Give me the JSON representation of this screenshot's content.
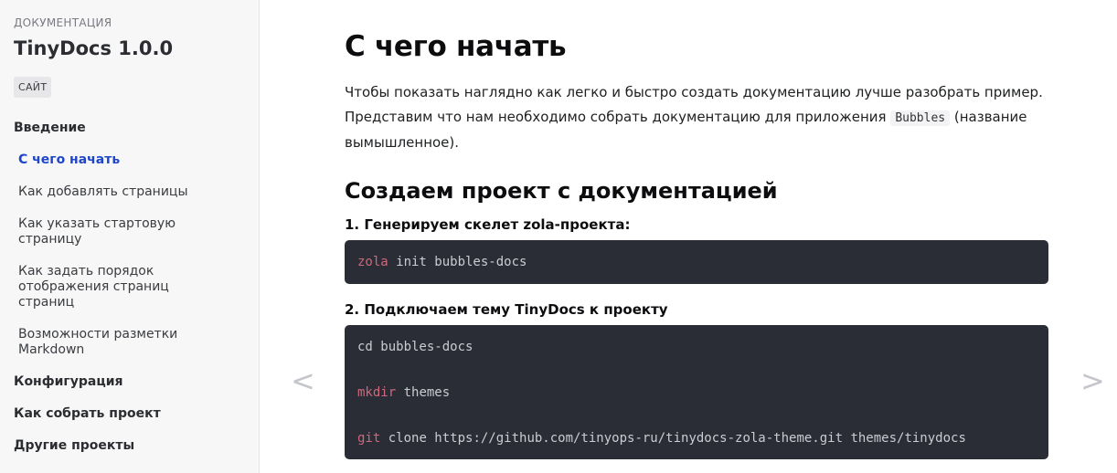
{
  "sidebar": {
    "eyebrow": "ДОКУМЕНТАЦИЯ",
    "brand": "TinyDocs 1.0.0",
    "site_button": "САЙТ",
    "sections": [
      {
        "label": "Введение",
        "items": [
          {
            "label": "С чего начать",
            "active": true
          },
          {
            "label": "Как добавлять страницы"
          },
          {
            "label": "Как указать стартовую страницу"
          },
          {
            "label": "Как задать порядок отображения страниц страниц"
          },
          {
            "label": "Возможности разметки Markdown"
          }
        ]
      },
      {
        "label": "Конфигурация"
      },
      {
        "label": "Как собрать проект"
      },
      {
        "label": "Другие проекты"
      }
    ]
  },
  "main": {
    "title": "С чего начать",
    "intro_before": "Чтобы показать наглядно как легко и быстро создать документацию лучше разобрать пример. Представим что нам необходимо собрать документацию для приложения ",
    "intro_code": "Bubbles",
    "intro_after": " (название вымышленное).",
    "h2": "Создаем проект с документацией",
    "step1": "1. Генерируем скелет zola-проекта:",
    "code1": {
      "kw": "zola",
      "rest": " init bubbles-docs"
    },
    "step2": "2. Подключаем тему TinyDocs к проекту",
    "code2": [
      {
        "kw": "",
        "cmd": "cd",
        "rest": " bubbles-docs"
      },
      {
        "kw": "mkdir",
        "cmd": "",
        "rest": " themes"
      },
      {
        "kw": "git",
        "cmd": "",
        "rest": " clone https://github.com/tinyops-ru/tinydocs-zola-theme.git themes/tinydocs"
      }
    ]
  },
  "nav": {
    "prev": "<",
    "next": ">"
  },
  "colors": {
    "accent": "#1f46c9",
    "code_bg": "#2a2d35",
    "code_keyword": "#d0677b",
    "sidebar_bg": "#f7f7f8"
  }
}
